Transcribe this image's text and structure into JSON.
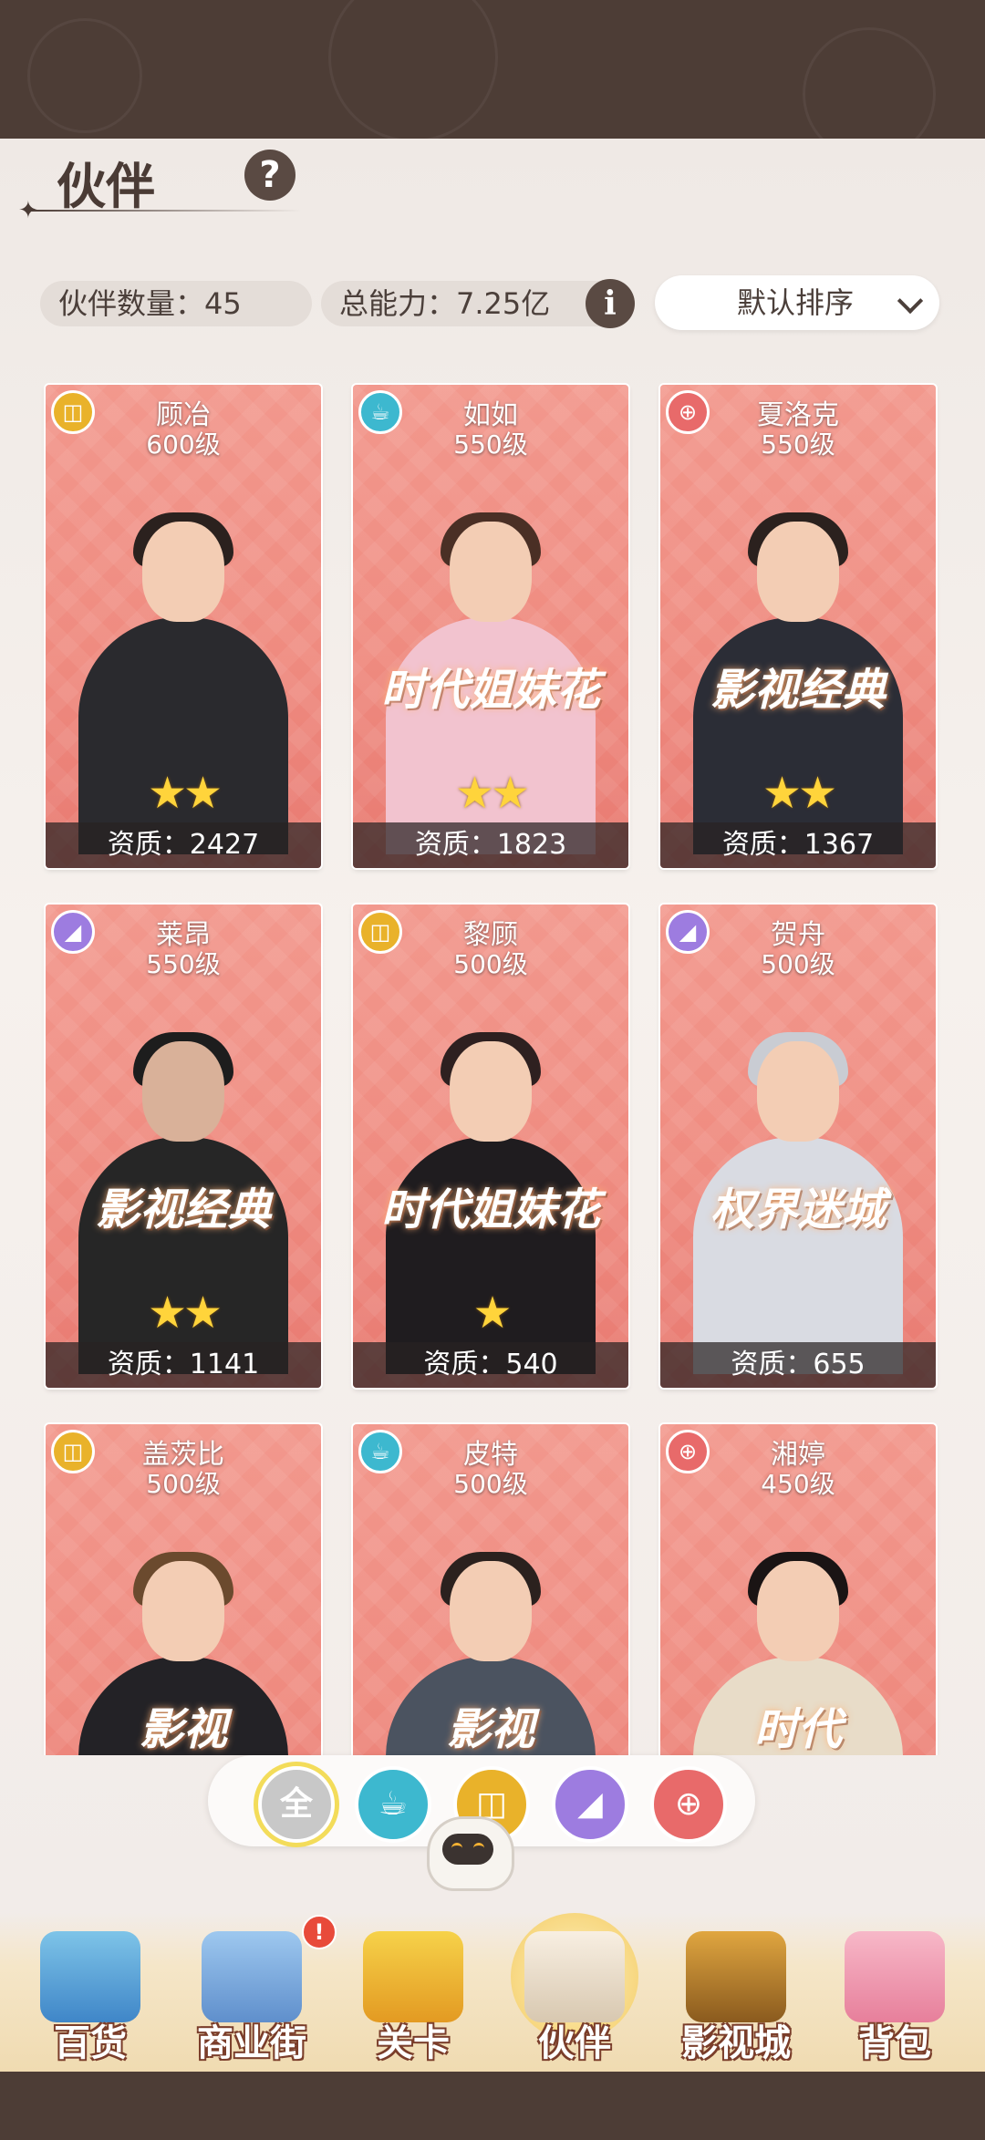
{
  "header": {
    "title": "伙伴",
    "help_icon": "?"
  },
  "stats": {
    "partner_count": "伙伴数量：45",
    "total_power": "总能力：7.25亿",
    "info_icon": "i"
  },
  "sort": {
    "label": "默认排序"
  },
  "cards": [
    {
      "name": "顾冶",
      "level": "600级",
      "stars": "★★",
      "quality": "资质：2427",
      "category": "shopping-bag",
      "slogan": ""
    },
    {
      "name": "如如",
      "level": "550级",
      "stars": "★★",
      "quality": "资质：1823",
      "category": "coffee-cup",
      "slogan": "时代姐妹花"
    },
    {
      "name": "夏洛克",
      "level": "550级",
      "stars": "★★",
      "quality": "资质：1367",
      "category": "gamepad",
      "slogan": "影视经典"
    },
    {
      "name": "莱昂",
      "level": "550级",
      "stars": "★★",
      "quality": "资质：1141",
      "category": "high-heel",
      "slogan": "影视经典"
    },
    {
      "name": "黎顾",
      "level": "500级",
      "stars": "★",
      "quality": "资质：540",
      "category": "shopping-bag",
      "slogan": "时代姐妹花"
    },
    {
      "name": "贺舟",
      "level": "500级",
      "stars": "",
      "quality": "资质：655",
      "category": "high-heel",
      "slogan": "权界迷城"
    },
    {
      "name": "盖茨比",
      "level": "500级",
      "stars": "",
      "quality": "",
      "category": "shopping-bag",
      "slogan": "影视"
    },
    {
      "name": "皮特",
      "level": "500级",
      "stars": "",
      "quality": "",
      "category": "coffee-cup",
      "slogan": "影视"
    },
    {
      "name": "湘婷",
      "level": "450级",
      "stars": "",
      "quality": "",
      "category": "gamepad",
      "slogan": "时代"
    }
  ],
  "filters": {
    "all_label": "全"
  },
  "nav": [
    {
      "label": "百货"
    },
    {
      "label": "商业街"
    },
    {
      "label": "关卡"
    },
    {
      "label": "伙伴"
    },
    {
      "label": "影视城"
    },
    {
      "label": "背包"
    }
  ],
  "badges": {
    "street_alert": "!"
  },
  "colors": {
    "card_bg": "#f2988d",
    "dark_band": "#4d3d36",
    "star": "#ffd43b"
  }
}
